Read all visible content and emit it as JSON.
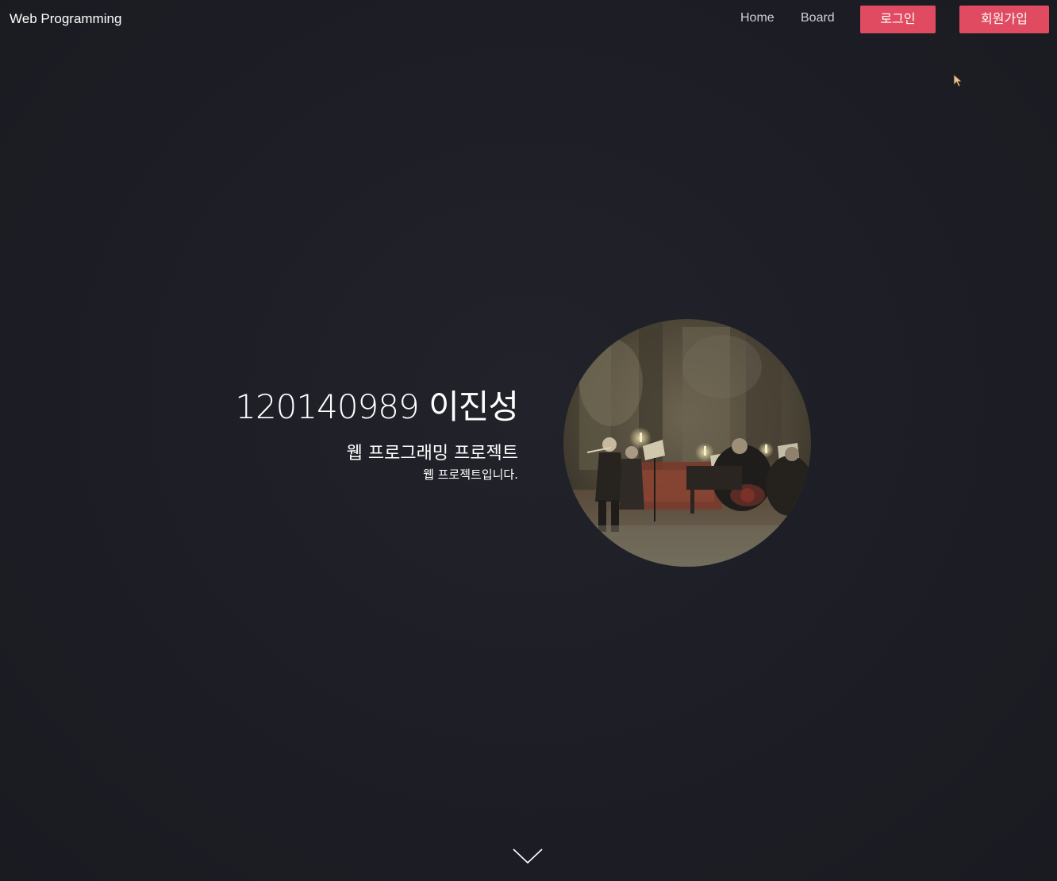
{
  "navbar": {
    "brand": "Web Programming",
    "links": [
      {
        "label": "Home"
      },
      {
        "label": "Board"
      }
    ],
    "login_label": "로그인",
    "signup_label": "회원가입"
  },
  "hero": {
    "title": "120140989 이진성",
    "subtitle": "웹 프로그래밍 프로젝트",
    "description": "웹 프로젝트입니다.",
    "image_icon": "concert-painting-image"
  },
  "scroll_icon": "chevron-down-icon",
  "colors": {
    "background": "#1d1d25",
    "accent": "#e04b61",
    "nav_text": "#cfcfd4"
  }
}
